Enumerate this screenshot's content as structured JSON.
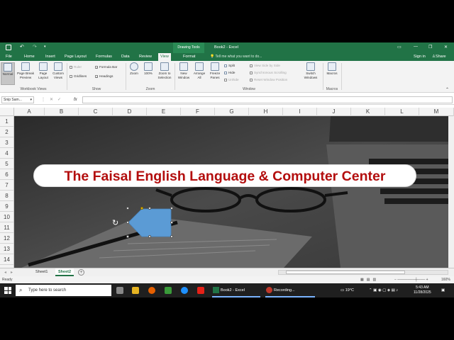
{
  "titlebar": {
    "context_tab": "Drawing Tools",
    "window_title": "Book2 - Excel"
  },
  "tabs": [
    "File",
    "Home",
    "Insert",
    "Page Layout",
    "Formulas",
    "Data",
    "Review",
    "View",
    "Format"
  ],
  "active_tab": "View",
  "tell_me": "Tell me what you want to do...",
  "sign_in": "Sign in",
  "share": "Share",
  "ribbon": {
    "workbook_views": {
      "label": "Workbook Views",
      "buttons": [
        "Normal",
        "Page Break Preview",
        "Page Layout",
        "Custom Views"
      ]
    },
    "show": {
      "label": "Show",
      "ruler": "Ruler",
      "gridlines": "Gridlines",
      "formula_bar": "Formula Bar",
      "headings": "Headings"
    },
    "zoom": {
      "label": "Zoom",
      "buttons": [
        "Zoom",
        "100%",
        "Zoom to Selection"
      ]
    },
    "window": {
      "label": "Window",
      "buttons": [
        "New Window",
        "Arrange All",
        "Freeze Panes"
      ],
      "split": "Split",
      "hide": "Hide",
      "unhide": "Unhide",
      "view_side": "View Side by Side",
      "sync_scroll": "Synchronous Scrolling",
      "reset_pos": "Reset Window Position",
      "switch": "Switch Windows"
    },
    "macros": {
      "label": "Macros",
      "button": "Macros"
    }
  },
  "formula_bar": {
    "name_box": "Snip Sam...",
    "fx": "fx",
    "value": ""
  },
  "columns": [
    "A",
    "B",
    "C",
    "D",
    "E",
    "F",
    "G",
    "H",
    "I",
    "J",
    "K",
    "L",
    "M"
  ],
  "rows": [
    "1",
    "2",
    "3",
    "4",
    "5",
    "6",
    "7",
    "8",
    "9",
    "10",
    "11",
    "12",
    "13",
    "14"
  ],
  "banner_text": "The Faisal English Language & Computer Center",
  "sheets": [
    "Sheet1",
    "Sheet2"
  ],
  "active_sheet": "Sheet2",
  "status": {
    "ready": "Ready",
    "zoom": "160%"
  },
  "taskbar": {
    "search_placeholder": "Type here to search",
    "excel_task": "Book2 - Excel",
    "recording_task": "Recording...",
    "weather": "19°C",
    "time": "5:43 AM",
    "date": "11/28/2025"
  },
  "colors": {
    "excel_green": "#217346",
    "banner_red": "#b30e0e",
    "shape_blue": "#5b9bd5"
  }
}
